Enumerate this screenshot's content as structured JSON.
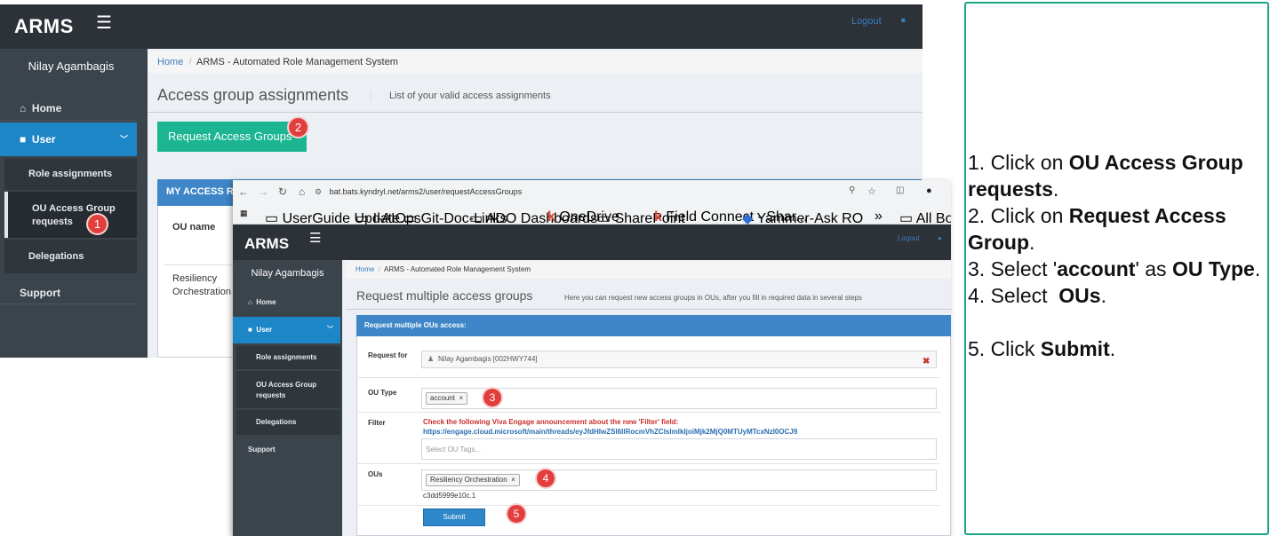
{
  "back": {
    "logo": "ARMS",
    "logout": "Logout",
    "user_name": "Nilay Agambagis",
    "nav": {
      "home": "Home",
      "user": "User",
      "role_assignments": "Role assignments",
      "ou_access_group_requests": "OU Access Group requests",
      "delegations": "Delegations",
      "support": "Support"
    },
    "breadcrumb": {
      "home": "Home",
      "current": "ARMS - Automated Role Management System"
    },
    "page_title": "Access group assignments",
    "page_subtitle": "List of your valid access assignments",
    "request_button": "Request Access Groups",
    "panel_title": "MY ACCESS RE",
    "table": {
      "header": "OU name",
      "rows": [
        "Resiliency Orchestration"
      ]
    },
    "badges": {
      "one": "1",
      "two": "2"
    }
  },
  "front": {
    "browser": {
      "url": "bat.bats.kyndryl.net/arms2/user/requestAccessGroups",
      "bookmarks": [
        "UserGuide Update...",
        "I-AIOps",
        "Git-Doc-Links",
        "ADO Dashboards",
        "OneDrive",
        "SharePoint",
        "Field Connect - Shar...",
        "Yammer-Ask RO",
        "All Bookma"
      ]
    },
    "logo": "ARMS",
    "logout": "Logout",
    "user_name": "Nilay Agambagis",
    "nav": {
      "home": "Home",
      "user": "User",
      "role_assignments": "Role assignments",
      "ou_access_group_requests": "OU Access Group requests",
      "delegations": "Delegations",
      "support": "Support"
    },
    "breadcrumb": {
      "home": "Home",
      "current": "ARMS - Automated Role Management System"
    },
    "page_title": "Request multiple access groups",
    "page_subtitle": "Here you can request new access groups in OUs, after you fill in required data in several steps",
    "panel_title": "Request multiple OUs access:",
    "form": {
      "request_for_label": "Request for",
      "request_for_value": "Nilay Agambagis [002HWY744]",
      "ou_type_label": "OU Type",
      "ou_type_value": "account",
      "filter_label": "Filter",
      "filter_notice": "Check the following Viva Engage announcement about the new 'Filter' field:",
      "filter_link": "https://engage.cloud.microsoft/main/threads/eyJfdHlwZSI6IlRocmVhZCIsImlkIjoiMjk2MjQ0MTUyMTcxNzI0OCJ9",
      "filter_placeholder": "Select OU Tags...",
      "ous_label": "OUs",
      "ous_value": "Resiliency Orchestration",
      "ous_subtext": "c3dd5999e10c.1",
      "submit": "Submit"
    },
    "badges": {
      "three": "3",
      "four": "4",
      "five": "5"
    }
  },
  "instructions": {
    "step1_prefix": "1. Click on ",
    "step1_bold": "OU Access Group requests",
    "step1_suffix": ".",
    "step2_prefix": "2. Click on ",
    "step2_bold": "Request Access Group",
    "step2_suffix": ".",
    "step3_prefix": "3. Select '",
    "step3_bold1": "account",
    "step3_mid": "' as ",
    "step3_bold2": "OU Type",
    "step3_suffix": ".",
    "step4_prefix": "4. Select  ",
    "step4_bold": "OUs",
    "step4_suffix": ".",
    "step5_prefix": "5. Click ",
    "step5_bold": "Submit",
    "step5_suffix": "."
  },
  "colors": {
    "accent": "#1c86c7",
    "request_button": "#1bb591",
    "badge": "#e33e3e",
    "instructions_border": "#1aa387"
  }
}
